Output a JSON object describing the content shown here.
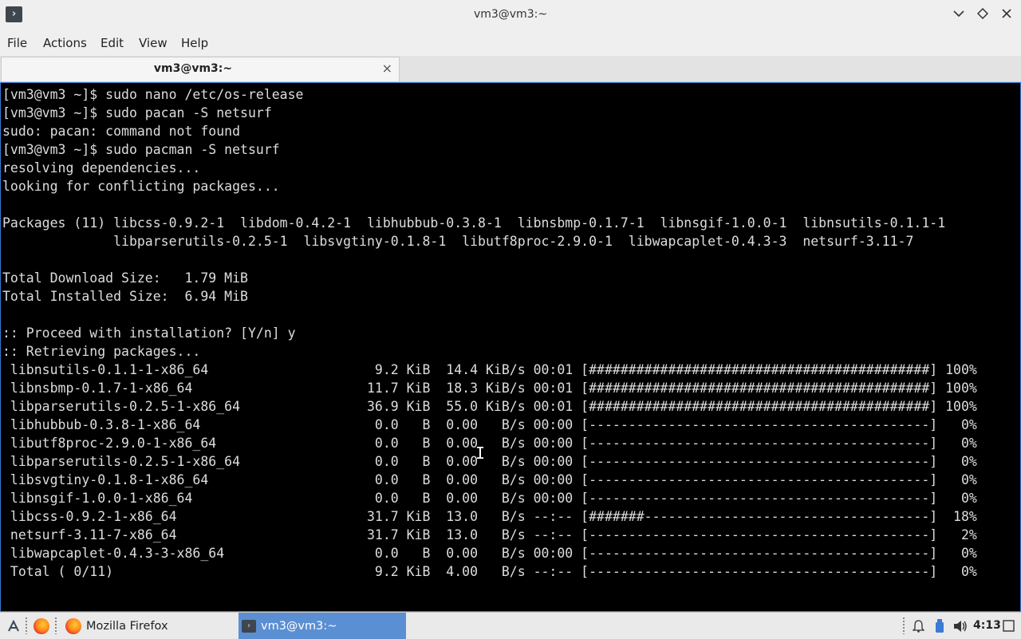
{
  "window": {
    "title": "vm3@vm3:~"
  },
  "menu": [
    "File",
    "Actions",
    "Edit",
    "View",
    "Help"
  ],
  "tab": {
    "label": "vm3@vm3:~",
    "close": "×"
  },
  "terminal": {
    "lines": [
      "[vm3@vm3 ~]$ sudo nano /etc/os-release",
      "[vm3@vm3 ~]$ sudo pacan -S netsurf",
      "sudo: pacan: command not found",
      "[vm3@vm3 ~]$ sudo pacman -S netsurf",
      "resolving dependencies...",
      "looking for conflicting packages...",
      "",
      "Packages (11) libcss-0.9.2-1  libdom-0.4.2-1  libhubbub-0.3.8-1  libnsbmp-0.1.7-1  libnsgif-1.0.0-1  libnsutils-0.1.1-1",
      "              libparserutils-0.2.5-1  libsvgtiny-0.1.8-1  libutf8proc-2.9.0-1  libwapcaplet-0.4.3-3  netsurf-3.11-7",
      "",
      "Total Download Size:   1.79 MiB",
      "Total Installed Size:  6.94 MiB",
      "",
      ":: Proceed with installation? [Y/n] y",
      ":: Retrieving packages...",
      " libnsutils-0.1.1-1-x86_64                     9.2 KiB  14.4 KiB/s 00:01 [###########################################] 100%",
      " libnsbmp-0.1.7-1-x86_64                      11.7 KiB  18.3 KiB/s 00:01 [###########################################] 100%",
      " libparserutils-0.2.5-1-x86_64                36.9 KiB  55.0 KiB/s 00:01 [###########################################] 100%",
      " libhubbub-0.3.8-1-x86_64                      0.0   B  0.00   B/s 00:00 [-------------------------------------------]   0%",
      " libutf8proc-2.9.0-1-x86_64                    0.0   B  0.00   B/s 00:00 [-------------------------------------------]   0%",
      " libparserutils-0.2.5-1-x86_64                 0.0   B  0.00   B/s 00:00 [-------------------------------------------]   0%",
      " libsvgtiny-0.1.8-1-x86_64                     0.0   B  0.00   B/s 00:00 [-------------------------------------------]   0%",
      " libnsgif-1.0.0-1-x86_64                       0.0   B  0.00   B/s 00:00 [-------------------------------------------]   0%",
      " libcss-0.9.2-1-x86_64                        31.7 KiB  13.0   B/s --:-- [#######------------------------------------]  18%",
      " netsurf-3.11-7-x86_64                        31.7 KiB  13.0   B/s --:-- [-------------------------------------------]   2%",
      " libwapcaplet-0.4.3-3-x86_64                   0.0   B  0.00   B/s 00:00 [-------------------------------------------]   0%",
      " Total ( 0/11)                                 9.2 KiB  4.00   B/s --:-- [-------------------------------------------]   0%"
    ]
  },
  "taskbar": {
    "firefox_task": "Mozilla Firefox",
    "terminal_task": "vm3@vm3:~",
    "clock": "4:13"
  },
  "icons": {
    "app": "terminal-icon",
    "minimize": "chevron-down-icon",
    "maximize": "diamond-icon",
    "close": "close-icon"
  }
}
